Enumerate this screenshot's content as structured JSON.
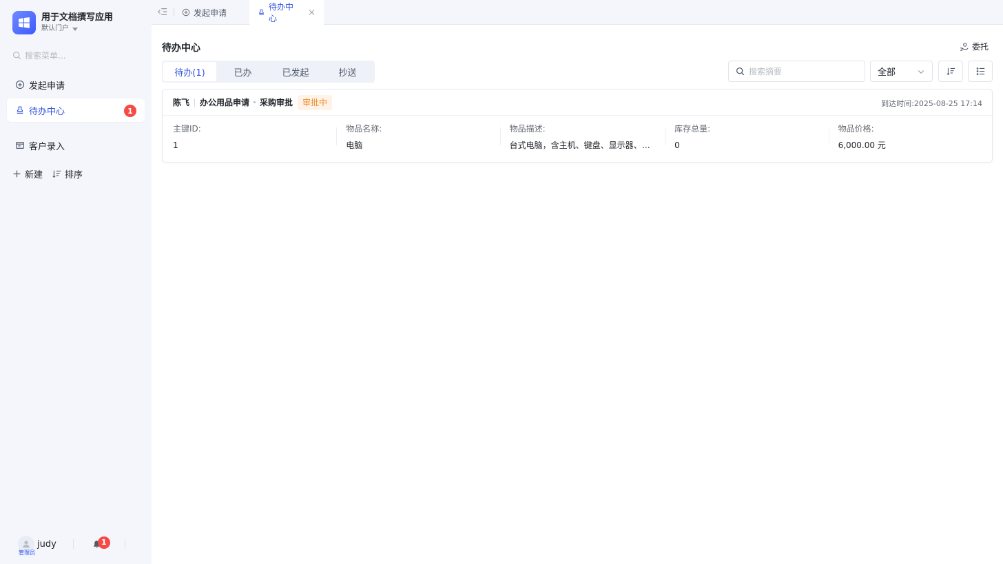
{
  "app": {
    "title": "用于文档撰写应用",
    "portal": "默认门户",
    "brand_color": "#4f6ef7"
  },
  "sidebar": {
    "search_placeholder": "搜索菜单...",
    "items": [
      {
        "label": "发起申请",
        "icon": "plus-circle-icon"
      },
      {
        "label": "待办中心",
        "icon": "stamp-icon",
        "badge": "1",
        "active": true
      },
      {
        "label": "客户录入",
        "icon": "form-icon"
      }
    ],
    "actions": {
      "new_label": "新建",
      "sort_label": "排序"
    },
    "footer": {
      "username": "judy",
      "role": "管理员",
      "notify_count": "1"
    }
  },
  "tabs": [
    {
      "label": "发起申请",
      "icon": "plus-circle-icon"
    },
    {
      "label": "待办中心",
      "icon": "stamp-icon",
      "active": true
    }
  ],
  "main": {
    "title": "待办中心",
    "delegate_label": "委托",
    "segments": [
      {
        "label": "待办(1)",
        "active": true
      },
      {
        "label": "已办"
      },
      {
        "label": "已发起"
      },
      {
        "label": "抄送"
      }
    ],
    "search_placeholder": "搜索摘要",
    "filter_value": "全部"
  },
  "tasks": [
    {
      "applicant": "陈飞",
      "form": "办公用品申请",
      "node": "采购审批",
      "status": "审批中",
      "arrive_label": "到达时间:",
      "arrive_time": "2025-08-25 17:14",
      "fields": [
        {
          "label": "主键ID:",
          "value": "1"
        },
        {
          "label": "物品名称:",
          "value": "电脑"
        },
        {
          "label": "物品描述:",
          "value": "台式电脑，含主机、键盘、显示器、鼠标"
        },
        {
          "label": "库存总量:",
          "value": "0"
        },
        {
          "label": "物品价格:",
          "value": "6,000.00 元"
        }
      ]
    }
  ],
  "colors": {
    "accent": "#3355e0",
    "badge": "#f54a45",
    "status_bg": "#fff3e8",
    "status_text": "#f08c2e",
    "sidebar_bg": "#f4f6fb"
  }
}
